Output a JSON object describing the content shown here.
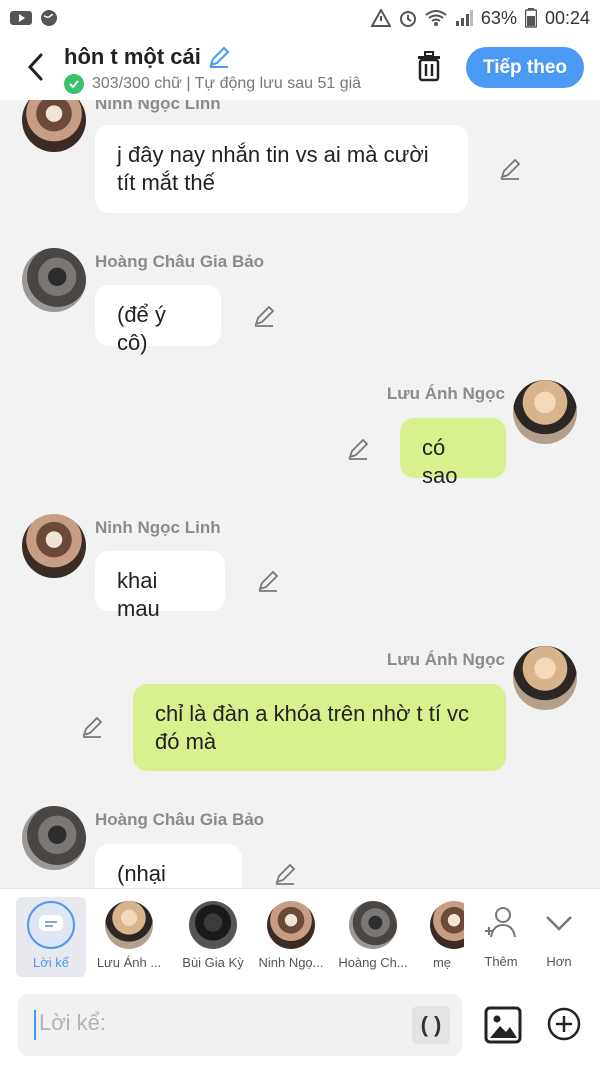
{
  "status": {
    "battery": "63%",
    "time": "00:24"
  },
  "header": {
    "title": "hôn t một cái",
    "subtitle": "303/300 chữ | Tự động lưu sau 51 giâ",
    "next_label": "Tiếp theo"
  },
  "messages": [
    {
      "sender": "Ninh Ngọc Linh",
      "text": "j đây nay nhắn tin vs ai mà cười tít mắt thế",
      "side": "left"
    },
    {
      "sender": "Hoàng Châu Gia Bảo",
      "text": "(để ý cô)",
      "side": "left"
    },
    {
      "sender": "Lưu Ánh Ngọc",
      "text": "có sao",
      "side": "right"
    },
    {
      "sender": "Ninh Ngọc Linh",
      "text": "khai mau",
      "side": "left"
    },
    {
      "sender": "Lưu Ánh Ngọc",
      "text": "chỉ là đàn a khóa trên nhờ t tí vc đó mà",
      "side": "right"
    },
    {
      "sender": "Hoàng Châu Gia Bảo",
      "text": "(nhại theo)",
      "side": "left"
    }
  ],
  "picker": {
    "items": [
      {
        "label": "Lời kể"
      },
      {
        "label": "Lưu Ánh ..."
      },
      {
        "label": "Bùi Gia Kỳ"
      },
      {
        "label": "Ninh Ngọ..."
      },
      {
        "label": "Hoàng Ch..."
      },
      {
        "label": "mẹ"
      },
      {
        "label": "Thêm"
      },
      {
        "label": "Hơn"
      }
    ]
  },
  "input": {
    "placeholder": "Lời kể:",
    "paren_label": "( )"
  },
  "colors": {
    "accent": "#4a9af5",
    "green_bubble": "#d8f18e",
    "check": "#3ac26a"
  }
}
